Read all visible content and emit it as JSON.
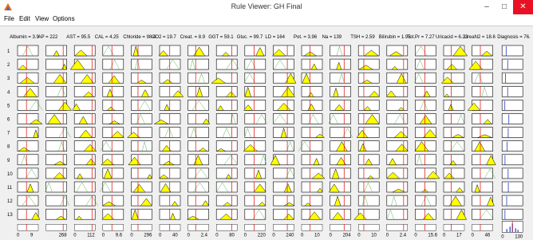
{
  "window": {
    "title": "Rule Viewer: GH Final",
    "min_label": "–",
    "max_label": "□",
    "close_label": "✕"
  },
  "menu": [
    "File",
    "Edit",
    "View",
    "Options"
  ],
  "inputs": [
    {
      "label": "Albumin = 3.9",
      "min": "0",
      "max": "9",
      "line": 0.43
    },
    {
      "label": "AP = 222",
      "min": "",
      "max": "268",
      "line": 0.83
    },
    {
      "label": "AST = 95.5",
      "min": "0",
      "max": "112",
      "line": 0.85
    },
    {
      "label": "CAL = 4.25",
      "min": "0",
      "max": "9.6",
      "line": 0.44
    },
    {
      "label": "Chloride = 98.4",
      "min": "0",
      "max": "296",
      "line": 0.33
    },
    {
      "label": "CO2 = 19.7",
      "min": "0",
      "max": "40",
      "line": 0.49
    },
    {
      "label": "Creat. = 8.9",
      "min": "0",
      "max": "2.4",
      "line": 0.37
    },
    {
      "label": "GGT = 59.1",
      "min": "0",
      "max": "80",
      "line": 0.74
    },
    {
      "label": "Gluc. = 99.7",
      "min": "0",
      "max": "220",
      "line": 0.45
    },
    {
      "label": "LD = 164",
      "min": "0",
      "max": "240",
      "line": 0.68
    },
    {
      "label": "Pot. = 3.96",
      "min": "0",
      "max": "10",
      "line": 0.4
    },
    {
      "label": "Na = 139",
      "min": "0",
      "max": "204",
      "line": 0.68
    },
    {
      "label": "TSH = 2.59",
      "min": "0",
      "max": "10",
      "line": 0.26
    },
    {
      "label": "Bilirubin = 1.95",
      "min": "0",
      "max": "2.4",
      "line": 0.81
    },
    {
      "label": "Tot.Pr = 7.27",
      "min": "0",
      "max": "15.6",
      "line": 0.47
    },
    {
      "label": "Uricacid = 6.23",
      "min": "0",
      "max": "17",
      "line": 0.37
    },
    {
      "label": "UreaN2 = 18.6",
      "min": "0",
      "max": "46",
      "line": 0.4
    }
  ],
  "output": {
    "label": "Diagnosis = 76.",
    "min": "0",
    "max": "130"
  },
  "rows": [
    "1",
    "2",
    "3",
    "4",
    "5",
    "6",
    "7",
    "8",
    "9",
    "10",
    "11",
    "12",
    "13"
  ],
  "colors": {
    "fill": "#ffff00",
    "line": "#e00000",
    "output_bar": "#1f3fbf",
    "panel_border": "#000000"
  }
}
